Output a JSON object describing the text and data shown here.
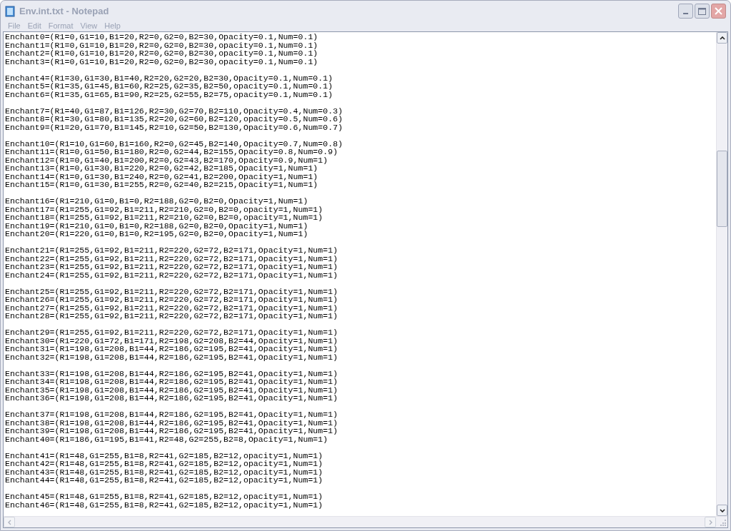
{
  "window": {
    "title": "Env.int.txt - Notepad"
  },
  "menu": [
    "File",
    "Edit",
    "Format",
    "View",
    "Help"
  ],
  "document": {
    "paragraphs": [
      [
        "Enchant0=(R1=0,G1=10,B1=20,R2=0,G2=0,B2=30,Opacity=0.1,Num=0.1)",
        "Enchant1=(R1=0,G1=10,B1=20,R2=0,G2=0,B2=30,opacity=0.1,Num=0.1)",
        "Enchant2=(R1=0,G1=10,B1=20,R2=0,G2=0,B2=30,opacity=0.1,Num=0.1)",
        "Enchant3=(R1=0,G1=10,B1=20,R2=0,G2=0,B2=30,opacity=0.1,Num=0.1)"
      ],
      [
        "Enchant4=(R1=30,G1=30,B1=40,R2=20,G2=20,B2=30,Opacity=0.1,Num=0.1)",
        "Enchant5=(R1=35,G1=45,B1=60,R2=25,G2=35,B2=50,opacity=0.1,Num=0.1)",
        "Enchant6=(R1=35,G1=65,B1=90,R2=25,G2=55,B2=75,opacity=0.1,Num=0.1)"
      ],
      [
        "Enchant7=(R1=40,G1=87,B1=126,R2=30,G2=70,B2=110,Opacity=0.4,Num=0.3)",
        "Enchant8=(R1=30,G1=80,B1=135,R2=20,G2=60,B2=120,opacity=0.5,Num=0.6)",
        "Enchant9=(R1=20,G1=70,B1=145,R2=10,G2=50,B2=130,Opacity=0.6,Num=0.7)"
      ],
      [
        "Enchant10=(R1=10,G1=60,B1=160,R2=0,G2=45,B2=140,Opacity=0.7,Num=0.8)",
        "Enchant11=(R1=0,G1=50,B1=180,R2=0,G2=44,B2=155,Opacity=0.8,Num=0.9)",
        "Enchant12=(R1=0,G1=40,B1=200,R2=0,G2=43,B2=170,Opacity=0.9,Num=1)",
        "Enchant13=(R1=0,G1=30,B1=220,R2=0,G2=42,B2=185,Opacity=1,Num=1)",
        "Enchant14=(R1=0,G1=30,B1=240,R2=0,G2=41,B2=200,Opacity=1,Num=1)",
        "Enchant15=(R1=0,G1=30,B1=255,R2=0,G2=40,B2=215,Opacity=1,Num=1)"
      ],
      [
        "Enchant16=(R1=210,G1=0,B1=0,R2=188,G2=0,B2=0,Opacity=1,Num=1)",
        "Enchant17=(R1=255,G1=92,B1=211,R2=210,G2=0,B2=0,opacity=1,Num=1)",
        "Enchant18=(R1=255,G1=92,B1=211,R2=210,G2=0,B2=0,opacity=1,Num=1)",
        "Enchant19=(R1=210,G1=0,B1=0,R2=188,G2=0,B2=0,Opacity=1,Num=1)",
        "Enchant20=(R1=220,G1=0,B1=0,R2=195,G2=0,B2=0,Opacity=1,Num=1)"
      ],
      [
        "Enchant21=(R1=255,G1=92,B1=211,R2=220,G2=72,B2=171,Opacity=1,Num=1)",
        "Enchant22=(R1=255,G1=92,B1=211,R2=220,G2=72,B2=171,Opacity=1,Num=1)",
        "Enchant23=(R1=255,G1=92,B1=211,R2=220,G2=72,B2=171,Opacity=1,Num=1)",
        "Enchant24=(R1=255,G1=92,B1=211,R2=220,G2=72,B2=171,Opacity=1,Num=1)"
      ],
      [
        "Enchant25=(R1=255,G1=92,B1=211,R2=220,G2=72,B2=171,Opacity=1,Num=1)",
        "Enchant26=(R1=255,G1=92,B1=211,R2=220,G2=72,B2=171,Opacity=1,Num=1)",
        "Enchant27=(R1=255,G1=92,B1=211,R2=220,G2=72,B2=171,Opacity=1,Num=1)",
        "Enchant28=(R1=255,G1=92,B1=211,R2=220,G2=72,B2=171,Opacity=1,Num=1)"
      ],
      [
        "Enchant29=(R1=255,G1=92,B1=211,R2=220,G2=72,B2=171,Opacity=1,Num=1)",
        "Enchant30=(R1=220,G1=72,B1=171,R2=198,G2=208,B2=44,Opacity=1,Num=1)",
        "Enchant31=(R1=198,G1=208,B1=44,R2=186,G2=195,B2=41,Opacity=1,Num=1)",
        "Enchant32=(R1=198,G1=208,B1=44,R2=186,G2=195,B2=41,Opacity=1,Num=1)"
      ],
      [
        "Enchant33=(R1=198,G1=208,B1=44,R2=186,G2=195,B2=41,Opacity=1,Num=1)",
        "Enchant34=(R1=198,G1=208,B1=44,R2=186,G2=195,B2=41,Opacity=1,Num=1)",
        "Enchant35=(R1=198,G1=208,B1=44,R2=186,G2=195,B2=41,Opacity=1,Num=1)",
        "Enchant36=(R1=198,G1=208,B1=44,R2=186,G2=195,B2=41,Opacity=1,Num=1)"
      ],
      [
        "Enchant37=(R1=198,G1=208,B1=44,R2=186,G2=195,B2=41,Opacity=1,Num=1)",
        "Enchant38=(R1=198,G1=208,B1=44,R2=186,G2=195,B2=41,Opacity=1,Num=1)",
        "Enchant39=(R1=198,G1=208,B1=44,R2=186,G2=195,B2=41,Opacity=1,Num=1)",
        "Enchant40=(R1=186,G1=195,B1=41,R2=48,G2=255,B2=8,Opacity=1,Num=1)"
      ],
      [
        "Enchant41=(R1=48,G1=255,B1=8,R2=41,G2=185,B2=12,opacity=1,Num=1)",
        "Enchant42=(R1=48,G1=255,B1=8,R2=41,G2=185,B2=12,opacity=1,Num=1)",
        "Enchant43=(R1=48,G1=255,B1=8,R2=41,G2=185,B2=12,opacity=1,Num=1)",
        "Enchant44=(R1=48,G1=255,B1=8,R2=41,G2=185,B2=12,opacity=1,Num=1)"
      ],
      [
        "Enchant45=(R1=48,G1=255,B1=8,R2=41,G2=185,B2=12,opacity=1,Num=1)",
        "Enchant46=(R1=48,G1=255,B1=8,R2=41,G2=185,B2=12,opacity=1,Num=1)"
      ]
    ]
  }
}
